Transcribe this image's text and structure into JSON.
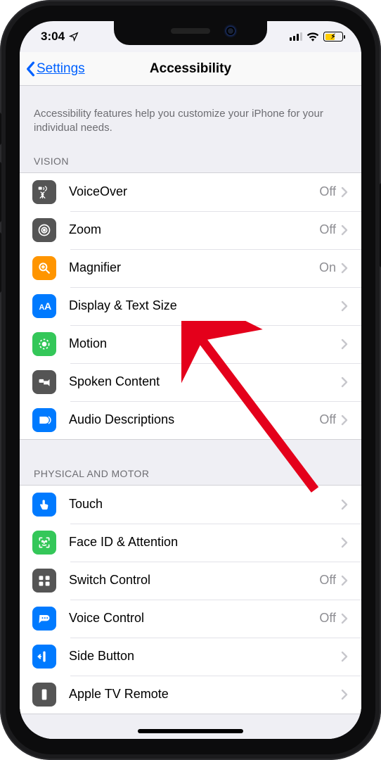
{
  "status": {
    "time": "3:04"
  },
  "nav": {
    "back": "Settings",
    "title": "Accessibility"
  },
  "note": "Accessibility features help you customize your iPhone for your individual needs.",
  "sections": {
    "vision": {
      "header": "VISION",
      "rows": [
        {
          "name": "voiceover",
          "label": "VoiceOver",
          "value": "Off",
          "color": "#555555"
        },
        {
          "name": "zoom",
          "label": "Zoom",
          "value": "Off",
          "color": "#555555"
        },
        {
          "name": "magnifier",
          "label": "Magnifier",
          "value": "On",
          "color": "#ff9500"
        },
        {
          "name": "display-text-size",
          "label": "Display & Text Size",
          "value": "",
          "color": "#007aff"
        },
        {
          "name": "motion",
          "label": "Motion",
          "value": "",
          "color": "#34c759"
        },
        {
          "name": "spoken-content",
          "label": "Spoken Content",
          "value": "",
          "color": "#555555"
        },
        {
          "name": "audio-descriptions",
          "label": "Audio Descriptions",
          "value": "Off",
          "color": "#007aff"
        }
      ]
    },
    "physical": {
      "header": "PHYSICAL AND MOTOR",
      "rows": [
        {
          "name": "touch",
          "label": "Touch",
          "value": "",
          "color": "#007aff"
        },
        {
          "name": "faceid-attention",
          "label": "Face ID & Attention",
          "value": "",
          "color": "#34c759"
        },
        {
          "name": "switch-control",
          "label": "Switch Control",
          "value": "Off",
          "color": "#555555"
        },
        {
          "name": "voice-control",
          "label": "Voice Control",
          "value": "Off",
          "color": "#007aff"
        },
        {
          "name": "side-button",
          "label": "Side Button",
          "value": "",
          "color": "#007aff"
        },
        {
          "name": "apple-tv-remote",
          "label": "Apple TV Remote",
          "value": "",
          "color": "#555555"
        }
      ]
    }
  },
  "icons": {
    "voiceover": "voiceover-icon",
    "zoom": "zoom-icon",
    "magnifier": "magnifier-icon",
    "display-text-size": "text-size-icon",
    "motion": "motion-icon",
    "spoken-content": "spoken-content-icon",
    "audio-descriptions": "audio-descriptions-icon",
    "touch": "touch-icon",
    "faceid-attention": "faceid-icon",
    "switch-control": "switch-control-icon",
    "voice-control": "voice-control-icon",
    "side-button": "side-button-icon",
    "apple-tv-remote": "tv-remote-icon"
  },
  "annotation": {
    "target": "display-text-size"
  }
}
